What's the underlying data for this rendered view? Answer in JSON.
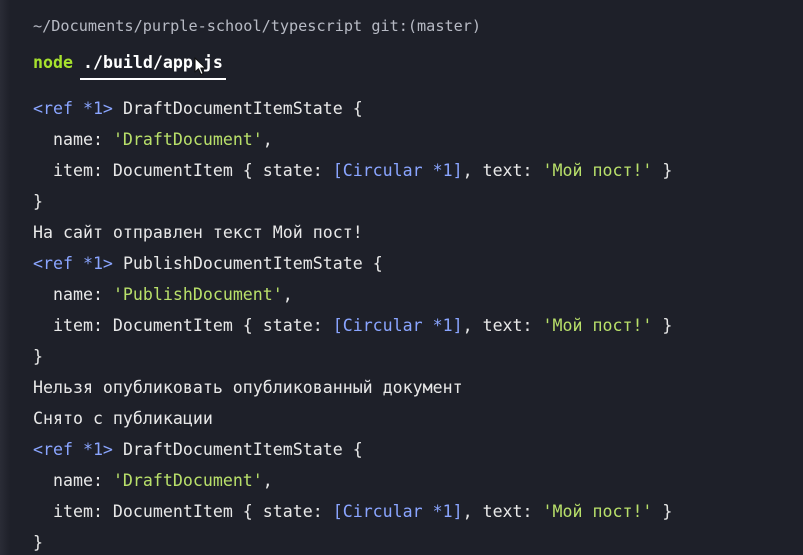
{
  "prompt": {
    "path": "~/Documents/purple-school/typescript git:(master)",
    "command": "node",
    "argument": "./build/app.js"
  },
  "output": {
    "block1": {
      "tag": "<ref *1>",
      "class_open": "DraftDocumentItemState {",
      "name_key": "name: ",
      "name_val": "'DraftDocument'",
      "comma": ",",
      "item_key": "item: DocumentItem { state: ",
      "circular": "[Circular *1]",
      "text_key": ", text: ",
      "text_val": "'Мой пост!'",
      "item_close": " }",
      "close": "}"
    },
    "msg1": "На сайт отправлен текст Мой пост!",
    "block2": {
      "tag": "<ref *1>",
      "class_open": "PublishDocumentItemState {",
      "name_key": "name: ",
      "name_val": "'PublishDocument'",
      "comma": ",",
      "item_key": "item: DocumentItem { state: ",
      "circular": "[Circular *1]",
      "text_key": ", text: ",
      "text_val": "'Мой пост!'",
      "item_close": " }",
      "close": "}"
    },
    "msg2": "Нельзя опубликовать опубликованный документ",
    "msg3": "Снято с публикации",
    "block3": {
      "tag": "<ref *1>",
      "class_open": "DraftDocumentItemState {",
      "name_key": "name: ",
      "name_val": "'DraftDocument'",
      "comma": ",",
      "item_key": "item: DocumentItem { state: ",
      "circular": "[Circular *1]",
      "text_key": ", text: ",
      "text_val": "'Мой пост!'",
      "item_close": " }",
      "close": "}"
    }
  },
  "colors": {
    "background": "#1e2029",
    "command": "#a7e22e",
    "string": "#b9e06a",
    "ref": "#8aa5ff"
  }
}
